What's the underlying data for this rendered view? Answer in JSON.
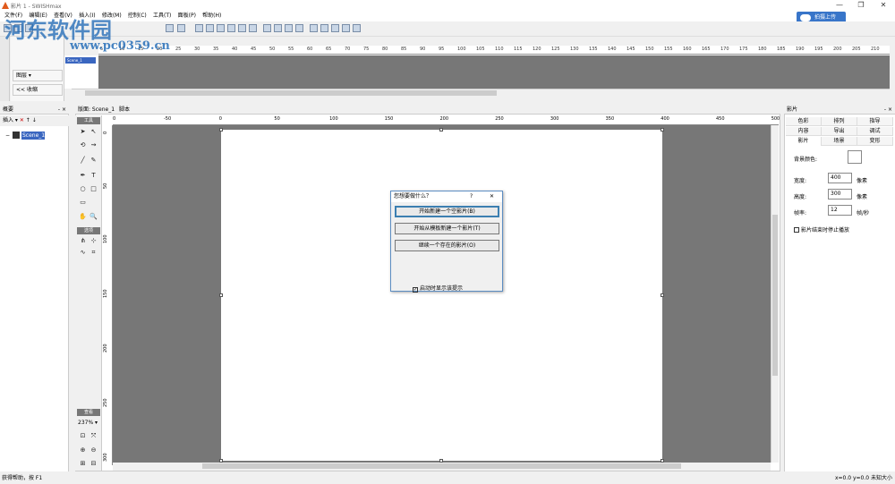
{
  "window": {
    "title": "影片 1 - SWISHmax",
    "min": "—",
    "restore": "❐",
    "close": "✕"
  },
  "menu": [
    "文件(F)",
    "编辑(E)",
    "查看(V)",
    "插入(I)",
    "修改(M)",
    "控制(C)",
    "工具(T)",
    "面板(P)",
    "帮助(H)"
  ],
  "upload_label": "拍摄上传",
  "watermark": {
    "main": "河东软件园",
    "url": "www.pc0359.cn"
  },
  "timeline": {
    "layers_btn": "图层",
    "collapse_btn": "<< 收缩",
    "scene_label": "Scene_1",
    "ruler": [
      "5",
      "10",
      "15",
      "20",
      "25",
      "30",
      "35",
      "40",
      "45",
      "50",
      "55",
      "60",
      "65",
      "70",
      "75",
      "80",
      "85",
      "90",
      "95",
      "100",
      "105",
      "110",
      "115",
      "120",
      "125",
      "130",
      "135",
      "140",
      "145",
      "150",
      "155",
      "160",
      "165",
      "170",
      "175",
      "180",
      "185",
      "190",
      "195",
      "200",
      "205",
      "210"
    ]
  },
  "outline": {
    "title": "概要",
    "insert": "插入",
    "scene": "Scene_1"
  },
  "stage": {
    "tab_layout": "版面: Scene_1",
    "tab_script": "脚本",
    "tools_header": "工具",
    "options_header": "选项",
    "view_header": "查看",
    "zoom": "237% ▾",
    "hruler": [
      "0",
      "-50",
      "0",
      "50",
      "100",
      "150",
      "200",
      "250",
      "300",
      "350",
      "400",
      "450",
      "500"
    ],
    "vruler": [
      "0",
      "50",
      "100",
      "150",
      "200",
      "250",
      "300"
    ]
  },
  "dialog": {
    "title": "您想要做什么？",
    "help": "?",
    "close": "✕",
    "btn_new": "开始新建一个空影片(B)",
    "btn_template": "开始从模板新建一个影片(T)",
    "btn_open": "继续一个存在的影片(O)",
    "checkbox": "启动时显示该提示",
    "checked": "✓"
  },
  "props": {
    "title": "影片",
    "tabs_row1": [
      "色彩",
      "排列",
      "指导"
    ],
    "tabs_row2": [
      "内容",
      "导出",
      "调试"
    ],
    "tabs_row3": [
      "影片",
      "场景",
      "变形"
    ],
    "bg_label": "背景颜色:",
    "width_label": "宽度:",
    "width_value": "400",
    "width_unit": "像素",
    "height_label": "高度:",
    "height_value": "300",
    "height_unit": "像素",
    "rate_label": "帧率:",
    "rate_value": "12",
    "rate_unit": "帧/秒",
    "stop_label": "影片结束时停止播放"
  },
  "status": {
    "left": "获得帮助，按 F1",
    "right": "x=0.0 y=0.0  未知大小"
  }
}
